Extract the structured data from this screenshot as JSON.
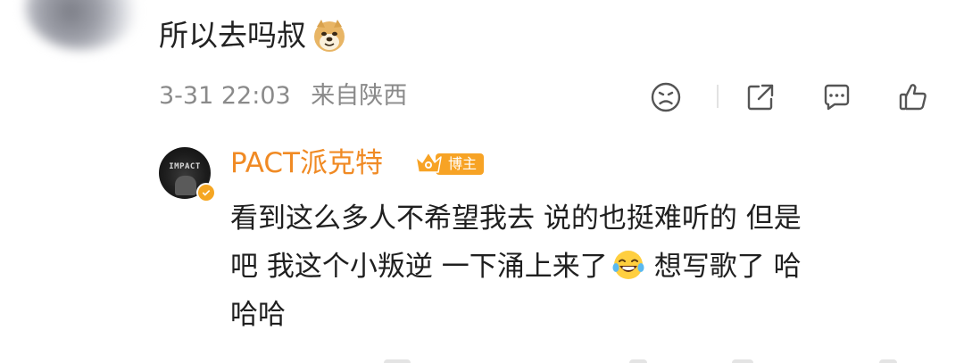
{
  "comment": {
    "text": "所以去吗叔",
    "emoji_icon": "doge-emoji-icon",
    "timestamp": "3-31 22:03",
    "location": "来自陕西"
  },
  "actions": [
    {
      "name": "dislike-icon"
    },
    {
      "name": "share-icon"
    },
    {
      "name": "comment-icon"
    },
    {
      "name": "like-icon"
    }
  ],
  "reply": {
    "author": "PACT派克特",
    "author_badge": "博主",
    "avatar_text": "IMPACT",
    "line1": "看到这么多人不希望我去 说的也挺难听的 但是",
    "line2_before": "吧 我这个小叛逆 一下涌上来了",
    "line2_after": "想写歌了 哈",
    "line3": "哈哈",
    "emoji_icon": "laugh-tears-emoji-icon"
  },
  "colors": {
    "author_name": "#f08a24",
    "badge": "#f7a325",
    "meta_text": "#8a8a8a",
    "body_text": "#1f1f1f"
  }
}
